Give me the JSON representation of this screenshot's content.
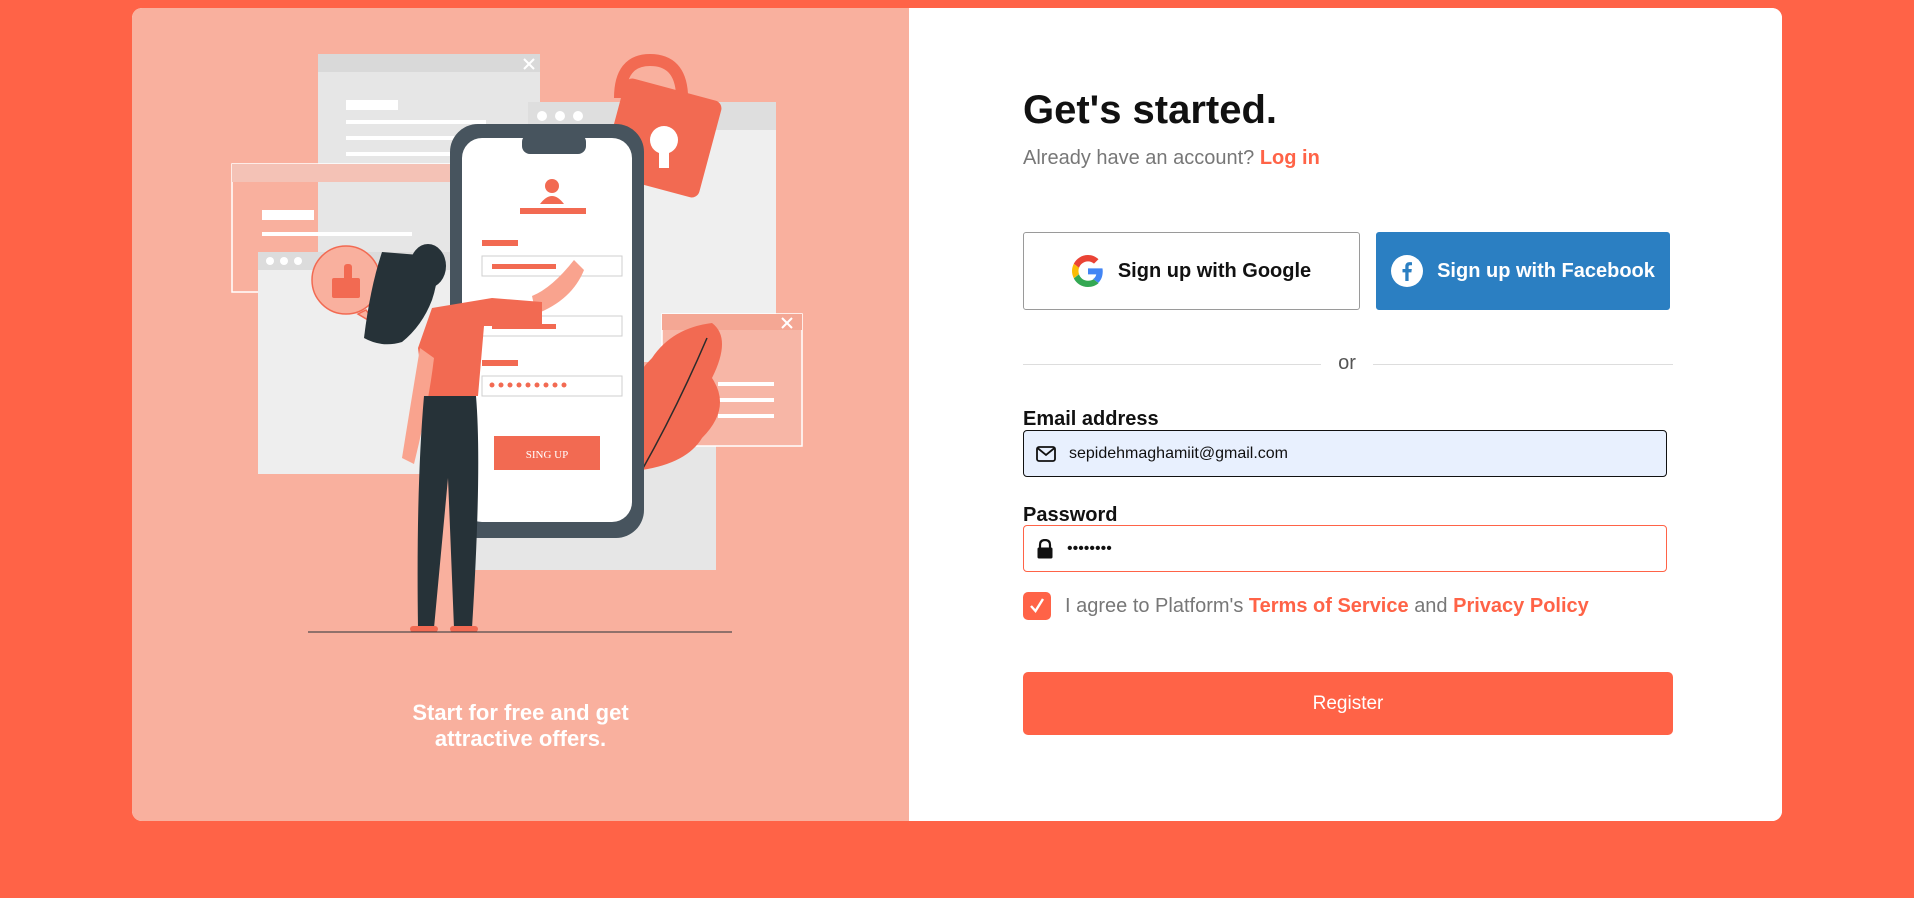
{
  "colors": {
    "background": "#ff6347",
    "accent": "#ff6347",
    "left_panel": "#f9b09e",
    "facebook": "#2b7fc2",
    "input_fill": "#e8f0fe"
  },
  "illustration": {
    "phone_button_label": "SING UP",
    "icons": [
      "user-icon",
      "lock-icon",
      "thumbs-up-icon",
      "close-icon",
      "leaf-icon"
    ]
  },
  "left_panel": {
    "tagline_line1": "Start for free and get",
    "tagline_line2": "attractive offers."
  },
  "header": {
    "title": "Get's started.",
    "subtitle_prefix": "Already have an account?",
    "login_link": "Log in"
  },
  "social": {
    "google_label": "Sign up with Google",
    "google_icon": "google-icon",
    "facebook_label": "Sign up with Facebook",
    "facebook_icon": "facebook-icon"
  },
  "divider": {
    "text": "or"
  },
  "form": {
    "email_label": "Email address",
    "email_value": "sepidehmaghamiit@gmail.com",
    "email_icon": "envelope-icon",
    "password_label": "Password",
    "password_value": "••••••••",
    "password_icon": "lock-icon",
    "agree_checked": true,
    "agree_prefix": "I agree to Platform's",
    "terms_link": "Terms of Service",
    "agree_and": "and",
    "privacy_link": "Privacy Policy",
    "register_label": "Register"
  }
}
